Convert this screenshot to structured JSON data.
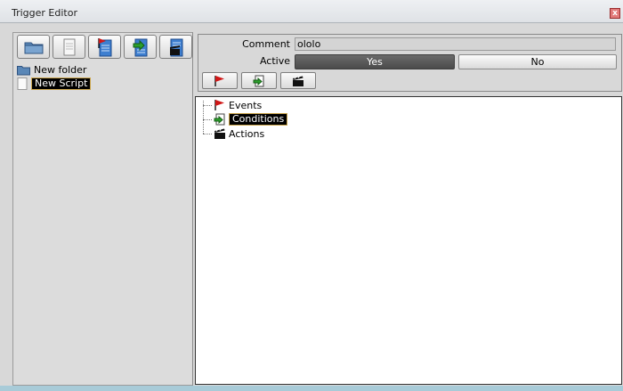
{
  "window": {
    "title": "Trigger Editor",
    "close_glyph": "x"
  },
  "left_toolbar": {
    "buttons": [
      {
        "icon": "folder-icon"
      },
      {
        "icon": "script-icon"
      },
      {
        "icon": "event-script-icon"
      },
      {
        "icon": "condition-script-icon"
      },
      {
        "icon": "action-script-icon"
      }
    ]
  },
  "left_tree": {
    "items": [
      {
        "label": "New folder",
        "icon": "folder-icon"
      },
      {
        "label": "New Script",
        "icon": "script-icon",
        "selected": true
      }
    ]
  },
  "properties": {
    "comment_label": "Comment",
    "comment_value": "ololo",
    "active_label": "Active",
    "active_yes": "Yes",
    "active_no": "No",
    "active_selected": "Yes"
  },
  "right_toolbar": {
    "buttons": [
      {
        "icon": "flag-icon"
      },
      {
        "icon": "condition-icon"
      },
      {
        "icon": "clapper-icon"
      }
    ]
  },
  "trigger_tree": {
    "items": [
      {
        "label": "Events",
        "icon": "flag-icon"
      },
      {
        "label": "Conditions",
        "icon": "condition-icon",
        "selected": true
      },
      {
        "label": "Actions",
        "icon": "clapper-icon"
      }
    ]
  },
  "colors": {
    "selection_bg": "#000000",
    "selection_border": "#caa44b",
    "flag_red": "#d01818",
    "arrow_green": "#2ca02c"
  }
}
